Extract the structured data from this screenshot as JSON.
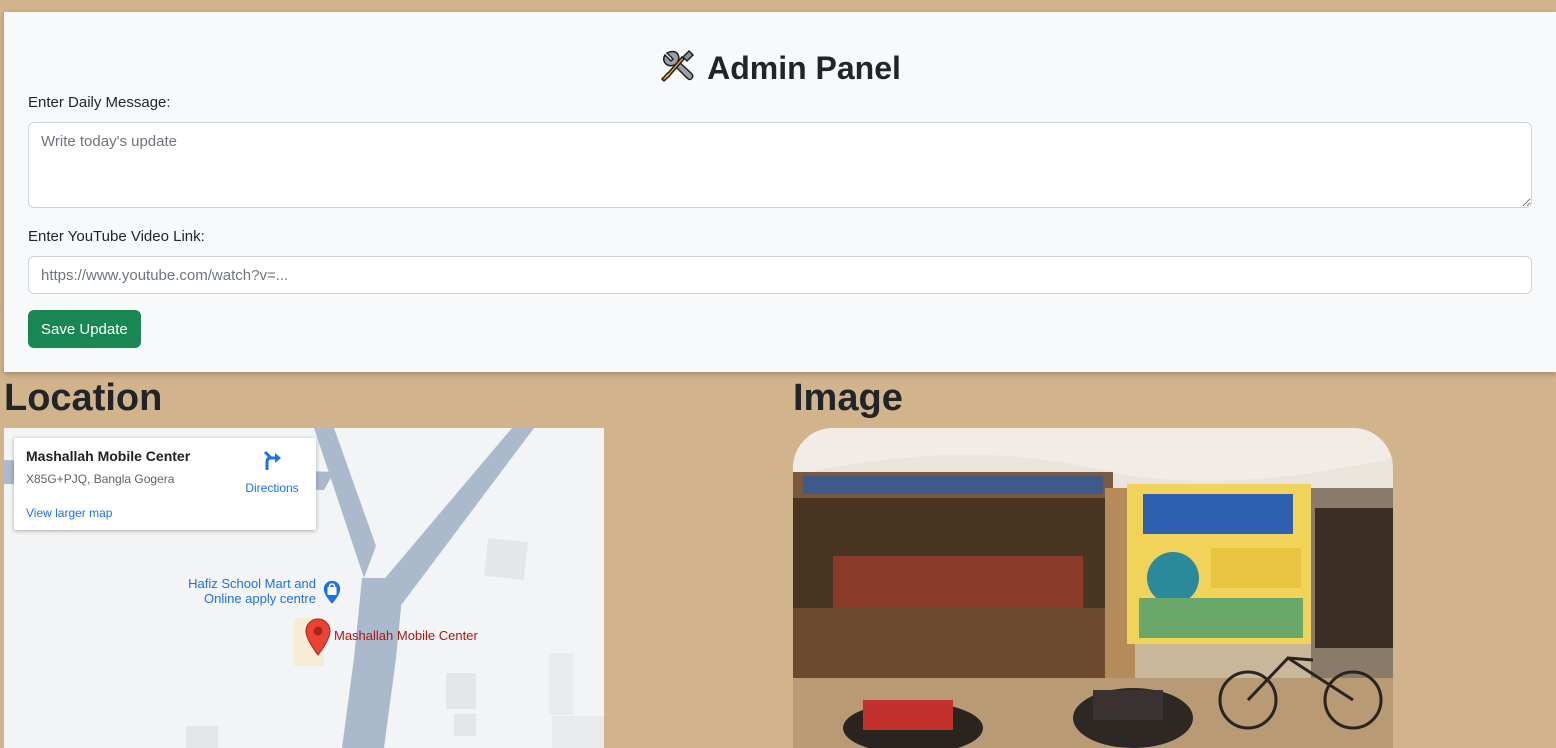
{
  "admin": {
    "title": "Admin Panel",
    "icon": "tools-icon",
    "message_label": "Enter Daily Message:",
    "message_placeholder": "Write today's update",
    "message_value": "",
    "youtube_label": "Enter YouTube Video Link:",
    "youtube_placeholder": "https://www.youtube.com/watch?v=...",
    "youtube_value": "",
    "save_label": "Save Update"
  },
  "location": {
    "heading": "Location",
    "map": {
      "place_name": "Mashallah Mobile Center",
      "address": "X85G+PJQ, Bangla Gogera",
      "directions_label": "Directions",
      "larger_map_label": "View larger map",
      "poi_label": "Hafiz School Mart and Online apply centre",
      "pin_label": "Mashallah Mobile Center"
    }
  },
  "image_section": {
    "heading": "Image"
  },
  "colors": {
    "page_background": "#d2b48c",
    "panel_background": "#f8f9fa",
    "save_button": "#198754",
    "map_link": "#1a73e8",
    "map_pin": "#ea4335",
    "road": "#aab9cc"
  }
}
